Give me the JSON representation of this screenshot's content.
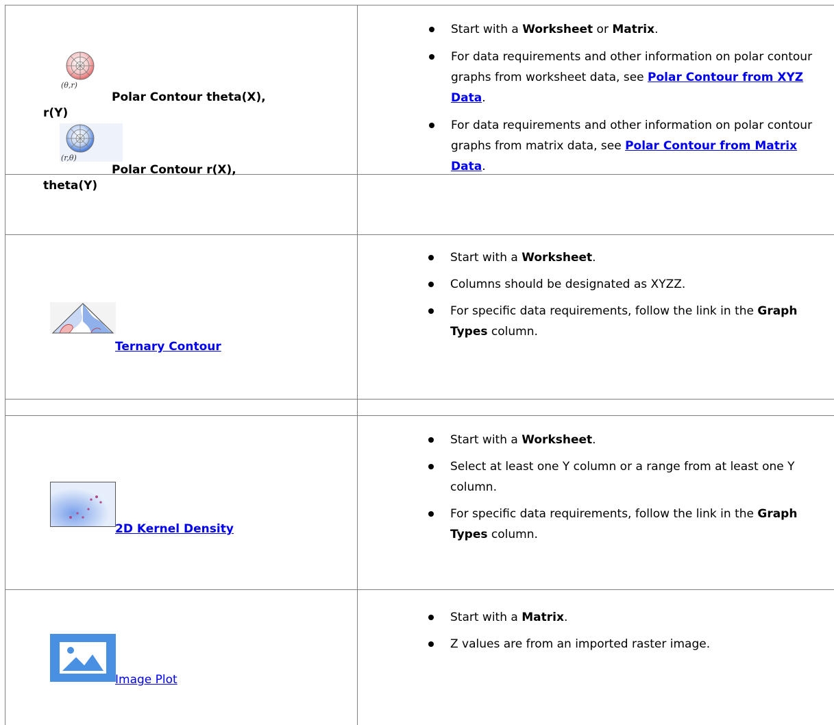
{
  "rows": [
    {
      "graph_types": [
        {
          "icon": "polar-contour-theta-r-icon",
          "icon_caption": "(θ,r)",
          "label": "Polar Contour theta(X), r(Y)",
          "label_line1": "Polar Contour theta(X),",
          "label_line2": "r(Y)"
        },
        {
          "icon": "polar-contour-r-theta-icon",
          "icon_caption": "(r,θ)",
          "label": "Polar Contour r(X), theta(Y)",
          "label_line1": "Polar Contour r(X),",
          "label_line2": "theta(Y)"
        }
      ],
      "b1": {
        "pre": "Start with a ",
        "bold1": "Worksheet",
        "mid": " or ",
        "bold2": "Matrix",
        "post": "."
      },
      "b2": {
        "pre": "For data requirements and other information on polar contour graphs from worksheet data, see ",
        "link": "Polar Contour from XYZ Data",
        "post": "."
      },
      "b3": {
        "pre": "For data requirements and other information on polar contour graphs from matrix data, see ",
        "link": "Polar Contour from Matrix Data",
        "post": "."
      }
    },
    {
      "graph_type": {
        "icon": "ternary-contour-icon",
        "link": "Ternary Contour"
      },
      "b1": {
        "pre": "Start with a ",
        "bold": "Worksheet",
        "post": "."
      },
      "b2": {
        "text": "Columns should be designated as XYZZ."
      },
      "b3": {
        "pre": "For specific data requirements, follow the link in the ",
        "bold": "Graph Types",
        "post": " column."
      }
    },
    {
      "graph_type": {
        "icon": "2d-kernel-density-icon",
        "link": "2D Kernel Density"
      },
      "b1": {
        "pre": "Start with a ",
        "bold": "Worksheet",
        "post": "."
      },
      "b2": {
        "text": "Select at least one Y column or a range from at least one Y column."
      },
      "b3": {
        "pre": "For specific data requirements, follow the link in the ",
        "bold": "Graph Types",
        "post": " column."
      }
    },
    {
      "graph_type": {
        "icon": "image-plot-icon",
        "link": "Image Plot"
      },
      "b1": {
        "pre": "Start with a ",
        "bold": "Matrix",
        "post": "."
      },
      "b2": {
        "text": "Z values are from an imported raster image."
      }
    }
  ],
  "colors": {
    "border": "#808080",
    "link": "#0000ee",
    "icon_blue": "#4a90e2"
  }
}
